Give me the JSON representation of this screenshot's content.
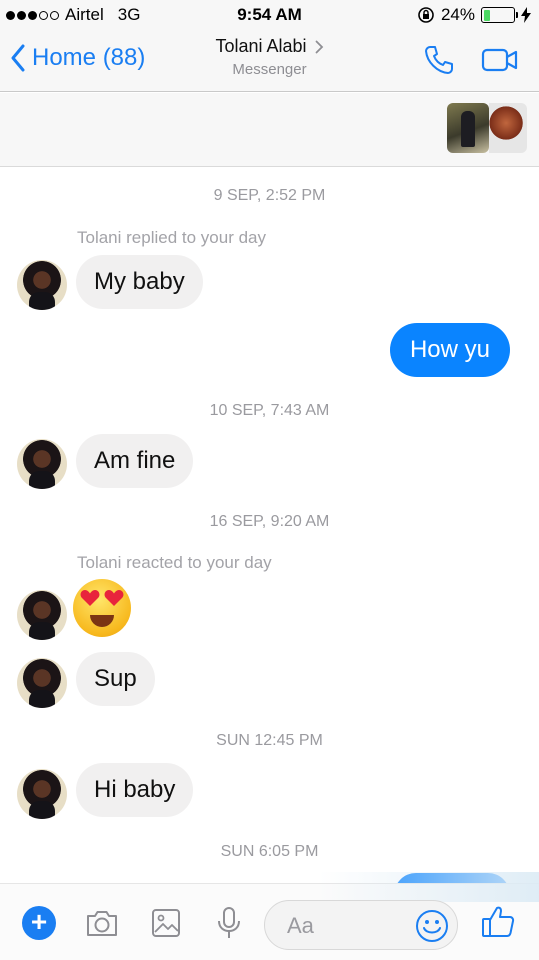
{
  "status_bar": {
    "carrier": "Airtel",
    "network": "3G",
    "time": "9:54 AM",
    "battery_percent": "24%",
    "battery_level": 0.24,
    "signal_bars_filled": 3,
    "signal_bars_total": 5
  },
  "nav": {
    "back_label": "Home (88)",
    "title": "Tolani Alabi",
    "subtitle": "Messenger",
    "icons": [
      "chevron-left-icon",
      "chevron-right-icon",
      "phone-icon",
      "video-camera-icon"
    ]
  },
  "colors": {
    "accent": "#1a7ef2",
    "outgoing_bubble": "#0a84ff",
    "incoming_bubble": "#f1f0f0",
    "muted_text": "#9a9a9f"
  },
  "messages": {
    "ts1": "9 SEP, 2:52 PM",
    "note1": "Tolani replied to your day",
    "in1": "My baby",
    "out1": "How yu",
    "ts2": "10 SEP, 7:43 AM",
    "in2": "Am fine",
    "ts3": "16 SEP, 9:20 AM",
    "note2": "Tolani reacted to your day",
    "emoji": "heart-eyes-emoji",
    "in3": "Sup",
    "ts4": "SUN 12:45 PM",
    "in4": "Hi baby",
    "ts5": "SUN 6:05 PM"
  },
  "composer": {
    "placeholder": "Aa",
    "icons": [
      "plus-icon",
      "camera-icon",
      "image-icon",
      "microphone-icon",
      "smiley-icon",
      "thumbs-up-icon"
    ]
  }
}
